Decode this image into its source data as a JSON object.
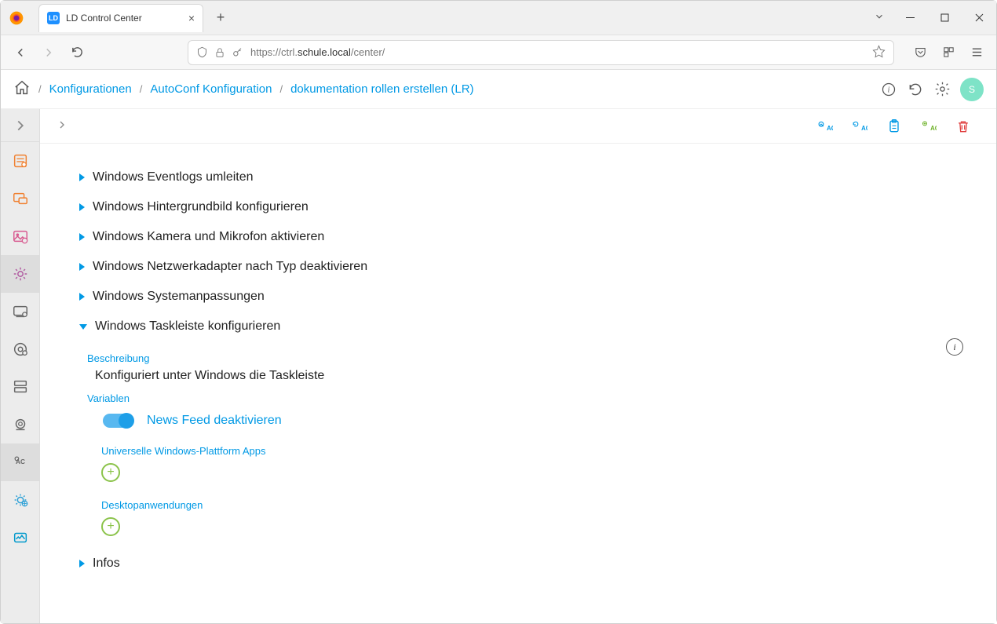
{
  "browser": {
    "tabTitle": "LD Control Center",
    "favicon": "LD",
    "urlPrefix": "https://ctrl.",
    "urlHost": "schule.local",
    "urlPath": "/center/"
  },
  "breadcrumbs": {
    "items": [
      "Konfigurationen",
      "AutoConf Konfiguration",
      "dokumentation rollen erstellen (LR)"
    ]
  },
  "avatar": "S",
  "tree": {
    "collapsed": [
      "Windows Eventlogs umleiten",
      "Windows Hintergrundbild konfigurieren",
      "Windows Kamera und Mikrofon aktivieren",
      "Windows Netzwerkadapter nach Typ deaktivieren",
      "Windows Systemanpassungen"
    ],
    "expanded": {
      "label": "Windows Taskleiste konfigurieren",
      "descriptionLabel": "Beschreibung",
      "descriptionText": "Konfiguriert unter Windows die Taskleiste",
      "variablesLabel": "Variablen",
      "toggleLabel": "News Feed deaktivieren",
      "uwpLabel": "Universelle Windows-Plattform Apps",
      "desktopLabel": "Desktopanwendungen"
    },
    "trailing": "Infos"
  },
  "actionBar": {
    "ac1": "AC",
    "ac2": "AC",
    "ac3": "AC"
  }
}
